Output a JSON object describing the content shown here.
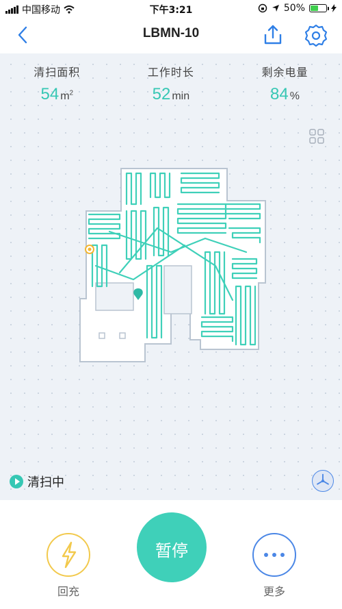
{
  "status_bar": {
    "carrier": "中国移动",
    "time": "下午3:21",
    "battery_text": "50%",
    "battery_level": 0.5
  },
  "nav": {
    "title": "LBMN-10"
  },
  "stats": [
    {
      "label": "清扫面积",
      "value": "54",
      "unit": "m",
      "unit_sup": "2"
    },
    {
      "label": "工作时长",
      "value": "52",
      "unit": "min",
      "unit_sup": ""
    },
    {
      "label": "剩余电量",
      "value": "84",
      "unit": "%",
      "unit_sup": ""
    }
  ],
  "status": {
    "text": "清扫中"
  },
  "controls": {
    "recharge_label": "回充",
    "pause_label": "暂停",
    "more_label": "更多"
  },
  "colors": {
    "accent": "#36c7b4",
    "path": "#3fd0b9",
    "recharge": "#f2c94c",
    "more": "#4b87e6"
  }
}
